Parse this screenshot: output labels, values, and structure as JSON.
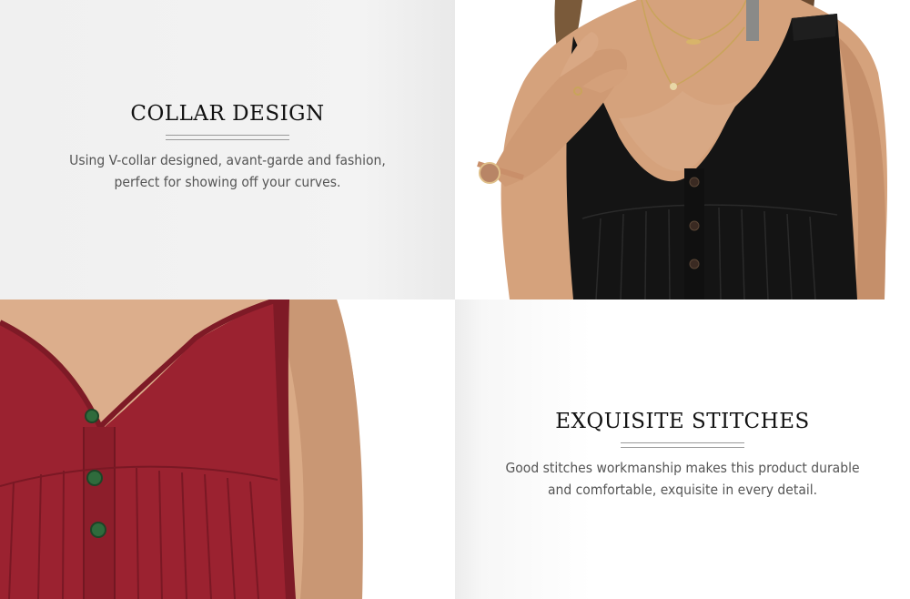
{
  "features": [
    {
      "heading": "COLLAR DESIGN",
      "description": "Using V-collar designed, avant-garde and fashion, perfect for showing off your curves."
    },
    {
      "heading": "EXQUISITE STITCHES",
      "description": "Good stitches workmanship makes this product durable and comfortable, exquisite in every detail."
    }
  ],
  "images": {
    "top": "black-sleeveless-tank-top-photo",
    "bottom": "red-sleeveless-tank-top-photo"
  },
  "colors": {
    "black_top": "#141414",
    "red_top": "#9b2230",
    "skin": "#d9a884",
    "button_dark": "#3a2a22",
    "button_green": "#2f6b3c"
  }
}
